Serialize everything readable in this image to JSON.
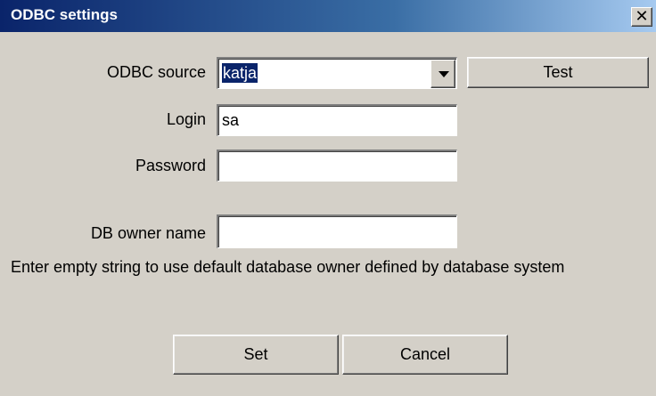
{
  "window": {
    "title": "ODBC settings",
    "close_glyph": "✕"
  },
  "form": {
    "odbc_source_label": "ODBC source",
    "odbc_source_value": "katja",
    "test_button": "Test",
    "login_label": "Login",
    "login_value": "sa",
    "password_label": "Password",
    "password_value": "",
    "db_owner_label": "DB owner name",
    "db_owner_value": "",
    "info_text": "Enter empty string to use default database owner defined by database system"
  },
  "buttons": {
    "set": "Set",
    "cancel": "Cancel"
  },
  "colors": {
    "title_bar": "#0a246a",
    "window_bg": "#d4d0c8",
    "selection": "#0a246a"
  },
  "icons": {
    "close": "close-icon",
    "dropdown": "chevron-down-icon"
  }
}
